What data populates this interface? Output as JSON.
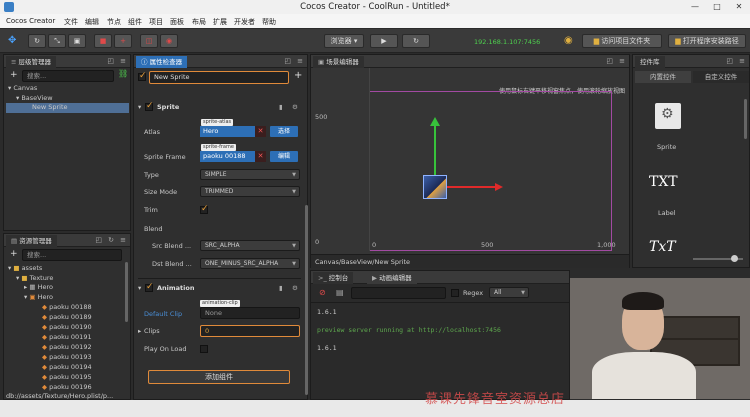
{
  "window": {
    "title": "Cocos Creator - CoolRun - Untitled*"
  },
  "menu": [
    "Cocos Creator",
    "文件",
    "编辑",
    "节点",
    "组件",
    "项目",
    "面板",
    "布局",
    "扩展",
    "开发者",
    "帮助"
  ],
  "toolbar": {
    "browser_label": "浏览器",
    "ip_address": "192.168.1.107:7456",
    "open_project_folder": "访问项目文件夹",
    "open_install_path": "打开程序安装路径"
  },
  "hierarchy": {
    "title": "层级管理器",
    "search_placeholder": "搜索...",
    "nodes": [
      "Canvas",
      "BaseView",
      "New Sprite"
    ]
  },
  "assets": {
    "title": "资源管理器",
    "search_placeholder": "搜索...",
    "items": [
      "assets",
      "Texture",
      "Hero",
      "Hero",
      "paoku 00188",
      "paoku 00189",
      "paoku 00190",
      "paoku 00191",
      "paoku 00192",
      "paoku 00193",
      "paoku 00194",
      "paoku 00195",
      "paoku 00196"
    ]
  },
  "inspector": {
    "title": "属性检查器",
    "node_name": "New Sprite",
    "sprite": {
      "header": "Sprite",
      "atlas_label": "Atlas",
      "atlas_tag": "sprite-atlas",
      "atlas_value": "Hero",
      "select_button": "选择",
      "frame_label": "Sprite Frame",
      "frame_tag": "sprite-frame",
      "frame_value": "paoku 00188",
      "edit_button": "编辑",
      "type_label": "Type",
      "type_value": "SIMPLE",
      "size_mode_label": "Size Mode",
      "size_mode_value": "TRIMMED",
      "trim_label": "Trim",
      "blend_label": "Blend",
      "src_blend_label": "Src Blend ...",
      "src_blend_value": "SRC_ALPHA",
      "dst_blend_label": "Dst Blend ...",
      "dst_blend_value": "ONE_MINUS_SRC_ALPHA"
    },
    "animation": {
      "header": "Animation",
      "default_clip_label": "Default Clip",
      "clip_tag": "animation-clip",
      "default_clip_value": "None",
      "clips_label": "Clips",
      "clips_value": "0",
      "play_on_load_label": "Play On Load"
    },
    "add_component_button": "添加组件"
  },
  "scene": {
    "title": "场景编辑器",
    "hint": "使用鼠标右键平移视窗焦点，使用滚轮缩放视图",
    "y_labels": [
      "500",
      "0"
    ],
    "x_labels": [
      "0",
      "500",
      "1,000"
    ],
    "breadcrumb": "Canvas/BaseView/New Sprite"
  },
  "console": {
    "tab_console": "控制台",
    "tab_animation": "动画编辑器",
    "regex_label": "Regex",
    "filter_value": "All",
    "lines": [
      "1.6.1",
      "preview server running at http://localhost:7456",
      "1.6.1"
    ]
  },
  "library": {
    "title": "控件库",
    "tab_builtin": "内置控件",
    "tab_custom": "自定义控件",
    "items": [
      "Sprite",
      "Label"
    ],
    "label_icon_text": "TXT"
  },
  "status": {
    "path": "db://assets/Texture/Hero.plist/p...",
    "watermark": "慕课先锋音室资源总店"
  },
  "colors": {
    "accent": "#2d6fb6",
    "canvas_outline": "#a24aa2",
    "axis_green": "#37c23b",
    "axis_red": "#e02a2a",
    "console_green": "#5ea84e"
  }
}
